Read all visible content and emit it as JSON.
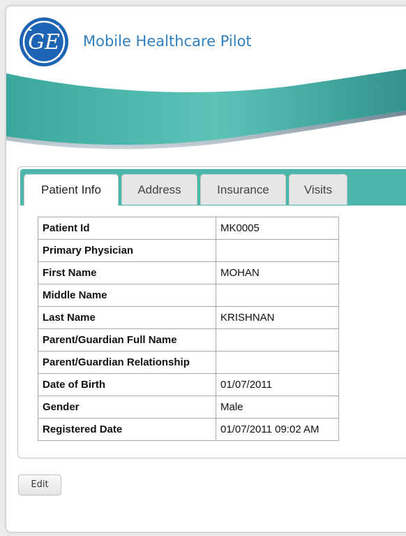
{
  "header": {
    "logo_text": "GE",
    "title": "Mobile Healthcare Pilot"
  },
  "colors": {
    "title": "#2f7fbf",
    "tab_bar": "#4bb6aa",
    "wave_dark": "#2e8f88",
    "wave_light": "#5cc3b7",
    "logo": "#1e64b4"
  },
  "tabs": [
    {
      "label": "Patient Info",
      "active": true
    },
    {
      "label": "Address",
      "active": false
    },
    {
      "label": "Insurance",
      "active": false
    },
    {
      "label": "Visits",
      "active": false
    }
  ],
  "patient": {
    "rows": [
      {
        "label": "Patient Id",
        "value": "MK0005"
      },
      {
        "label": "Primary Physician",
        "value": ""
      },
      {
        "label": "First Name",
        "value": "MOHAN"
      },
      {
        "label": "Middle Name",
        "value": ""
      },
      {
        "label": "Last Name",
        "value": "KRISHNAN"
      },
      {
        "label": "Parent/Guardian Full Name",
        "value": ""
      },
      {
        "label": "Parent/Guardian Relationship",
        "value": ""
      },
      {
        "label": "Date of Birth",
        "value": "01/07/2011"
      },
      {
        "label": "Gender",
        "value": "Male"
      },
      {
        "label": "Registered Date",
        "value": "01/07/2011 09:02 AM"
      }
    ]
  },
  "actions": {
    "edit_label": "Edit"
  }
}
